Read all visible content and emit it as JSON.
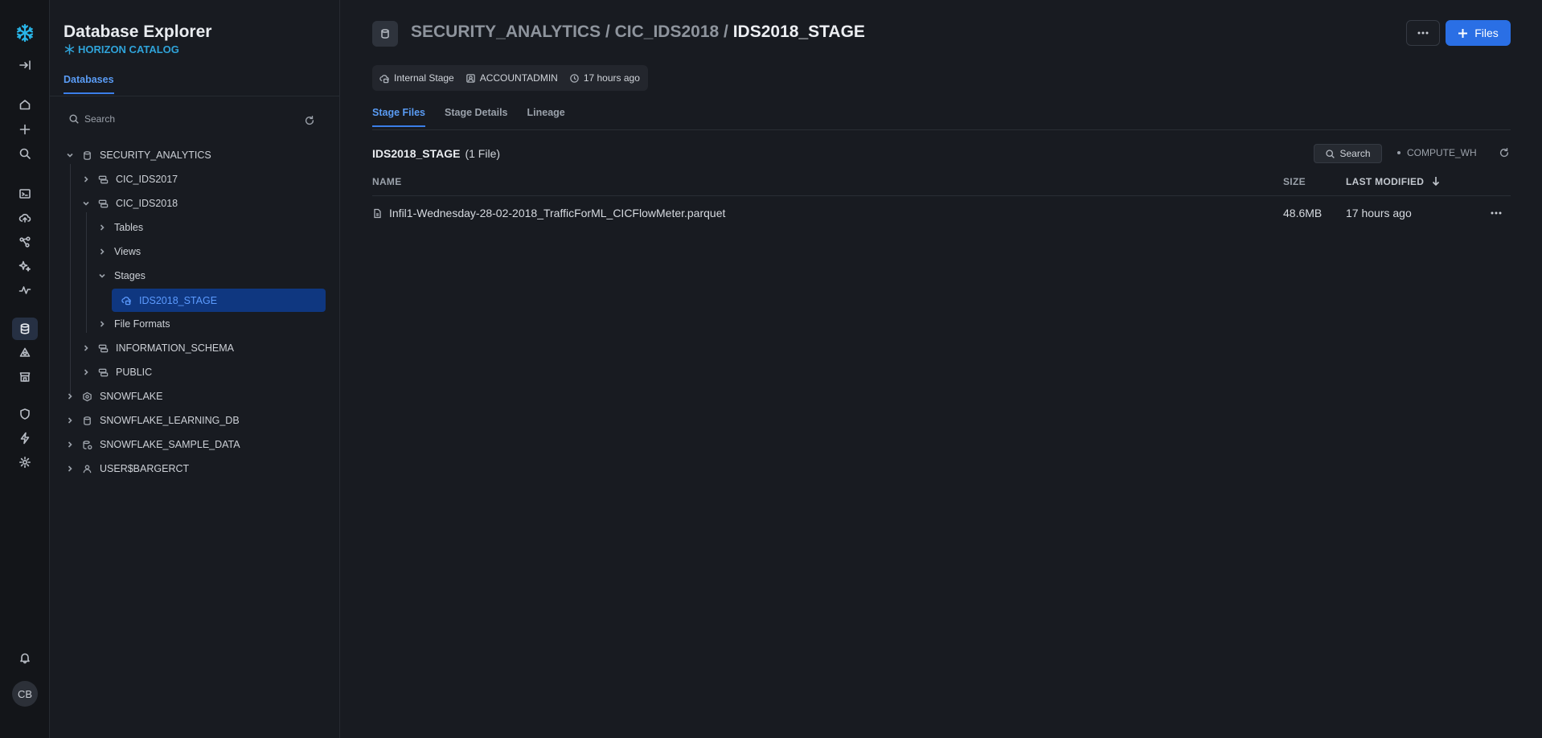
{
  "rail": {
    "icons": [
      "snowflake-logo-icon",
      "collapse-sidebar-icon",
      "home-icon",
      "plus-icon",
      "search-icon",
      "worksheets-icon",
      "data-upload-icon",
      "graph-icon",
      "ai-icon",
      "monitoring-icon",
      "database-icon",
      "data-sharing-icon",
      "marketplace-icon",
      "governance-shield-icon",
      "bolt-icon",
      "settings-gear-icon",
      "notifications-bell-icon"
    ],
    "avatar": "CB",
    "accent": "#29b5e8"
  },
  "explorer": {
    "title": "Database Explorer",
    "subtitle": "HORIZON CATALOG",
    "tab": "Databases",
    "search_placeholder": "Search",
    "tree": [
      {
        "label": "SECURITY_ANALYTICS",
        "icon": "database-icon",
        "expanded": true
      },
      {
        "label": "CIC_IDS2017",
        "icon": "schema-icon",
        "expanded": false
      },
      {
        "label": "CIC_IDS2018",
        "icon": "schema-icon",
        "expanded": true
      },
      {
        "label": "Tables",
        "expanded": false
      },
      {
        "label": "Views",
        "expanded": false
      },
      {
        "label": "Stages",
        "expanded": true
      },
      {
        "label": "IDS2018_STAGE",
        "icon": "stage-icon",
        "selected": true
      },
      {
        "label": "File Formats",
        "expanded": false
      },
      {
        "label": "INFORMATION_SCHEMA",
        "icon": "schema-icon",
        "expanded": false
      },
      {
        "label": "PUBLIC",
        "icon": "schema-icon",
        "expanded": false
      },
      {
        "label": "SNOWFLAKE",
        "icon": "system-db-icon",
        "expanded": false
      },
      {
        "label": "SNOWFLAKE_LEARNING_DB",
        "icon": "database-icon",
        "expanded": false
      },
      {
        "label": "SNOWFLAKE_SAMPLE_DATA",
        "icon": "shared-db-icon",
        "expanded": false
      },
      {
        "label": "USER$BARGERCT",
        "icon": "user-icon",
        "expanded": false
      }
    ]
  },
  "main": {
    "breadcrumb": {
      "db": "SECURITY_ANALYTICS",
      "sep1": " / ",
      "schema": "CIC_IDS2018",
      "sep2": " / ",
      "stage": "IDS2018_STAGE"
    },
    "files_button": "Files",
    "meta": {
      "type": "Internal Stage",
      "owner": "ACCOUNTADMIN",
      "created": "17 hours ago"
    },
    "tabs": [
      "Stage Files",
      "Stage Details",
      "Lineage"
    ],
    "active_tab": "Stage Files",
    "list_title": "IDS2018_STAGE",
    "file_count": "(1 File)",
    "search_label": "Search",
    "warehouse": "COMPUTE_WH",
    "columns": {
      "name": "NAME",
      "size": "SIZE",
      "last_modified": "LAST MODIFIED"
    },
    "sort_direction": "descending",
    "rows": [
      {
        "name": "Infil1-Wednesday-28-02-2018_TrafficForML_CICFlowMeter.parquet",
        "size": "48.6MB",
        "last_modified": "17 hours ago"
      }
    ],
    "primary_color": "#2a6fe5"
  }
}
